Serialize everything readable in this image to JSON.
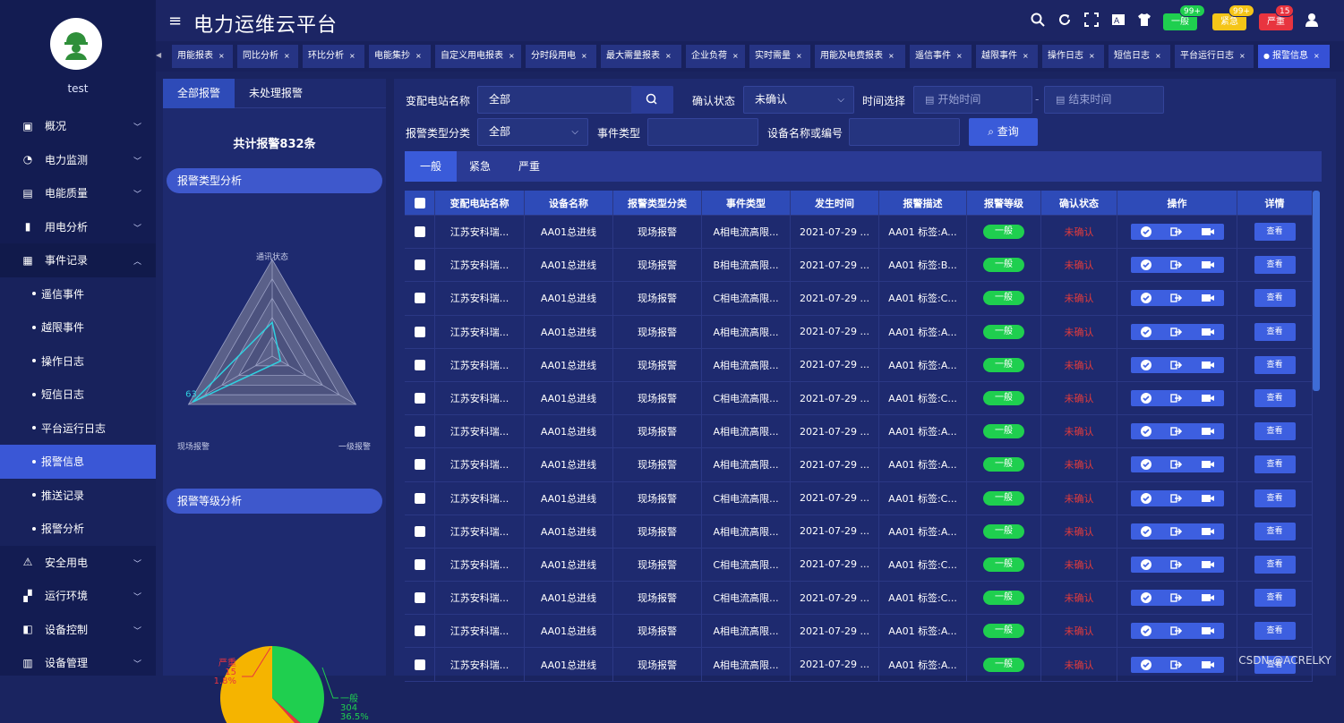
{
  "sidebar": {
    "username": "test",
    "menu": [
      {
        "label": "概况",
        "icon": "monitor-icon",
        "type": "group",
        "expanded": false
      },
      {
        "label": "电力监测",
        "icon": "gauge-icon",
        "type": "group",
        "expanded": false
      },
      {
        "label": "电能质量",
        "icon": "quality-icon",
        "type": "group",
        "expanded": false
      },
      {
        "label": "用电分析",
        "icon": "bar-chart-icon",
        "type": "group",
        "expanded": false
      },
      {
        "label": "事件记录",
        "icon": "record-icon",
        "type": "group",
        "expanded": true
      },
      {
        "label": "遥信事件",
        "type": "sub"
      },
      {
        "label": "越限事件",
        "type": "sub"
      },
      {
        "label": "操作日志",
        "type": "sub"
      },
      {
        "label": "短信日志",
        "type": "sub"
      },
      {
        "label": "平台运行日志",
        "type": "sub"
      },
      {
        "label": "报警信息",
        "type": "sub",
        "active": true
      },
      {
        "label": "推送记录",
        "type": "sub"
      },
      {
        "label": "报警分析",
        "type": "sub"
      },
      {
        "label": "安全用电",
        "icon": "safety-icon",
        "type": "group",
        "expanded": false
      },
      {
        "label": "运行环境",
        "icon": "environment-icon",
        "type": "group",
        "expanded": false
      },
      {
        "label": "设备控制",
        "icon": "device-control-icon",
        "type": "group",
        "expanded": false
      },
      {
        "label": "设备管理",
        "icon": "device-manage-icon",
        "type": "group",
        "expanded": false
      }
    ]
  },
  "header": {
    "title": "电力运维云平台",
    "alerts": [
      {
        "label": "一般",
        "badge": "99+",
        "color": "#1fcf4f"
      },
      {
        "label": "紧急",
        "badge": "99+",
        "color": "#f5c518"
      },
      {
        "label": "严重",
        "badge": "15",
        "color": "#e8343f"
      }
    ]
  },
  "tabs": [
    "用能报表",
    "同比分析",
    "环比分析",
    "电能集抄",
    "自定义用电报表",
    "分时段用电",
    "最大需量报表",
    "企业负荷",
    "实时需量",
    "用能及电费报表",
    "遥信事件",
    "越限事件",
    "操作日志",
    "短信日志",
    "平台运行日志",
    "报警信息"
  ],
  "active_tab": "报警信息",
  "left_panel": {
    "tabs": [
      "全部报警",
      "未处理报警"
    ],
    "total": "共计报警832条",
    "type_section": "报警类型分析",
    "level_section": "报警等级分析",
    "radar": {
      "axes": [
        "通讯状态",
        "一级报警",
        "现场报警"
      ],
      "value_label": "63",
      "values": [
        0.35,
        0.1,
        0.95
      ]
    },
    "pie": {
      "slices": [
        {
          "name": "一般",
          "value": 304,
          "percent": "36.5%",
          "color": "#1fcf4f"
        },
        {
          "name": "严重",
          "value": 15,
          "percent": "1.8%",
          "color": "#e8343f"
        },
        {
          "name": "紧急",
          "value": 513,
          "percent": "61.7%",
          "color": "#f5b400"
        }
      ],
      "label_general": [
        "一般",
        "304",
        "36.5%"
      ],
      "label_severe": [
        "严重",
        "15",
        "1.8%"
      ],
      "label_urgent": "紧急"
    }
  },
  "filters": {
    "station_label": "变配电站名称",
    "station_value": "全部",
    "confirm_label": "确认状态",
    "confirm_value": "未确认",
    "time_label": "时间选择",
    "start_placeholder": "开始时间",
    "end_placeholder": "结束时间",
    "alarm_type_label": "报警类型分类",
    "alarm_type_value": "全部",
    "event_type_label": "事件类型",
    "device_label": "设备名称或编号",
    "query_label": "查询",
    "dash": "-"
  },
  "table_tabs": [
    "一般",
    "紧急",
    "严重"
  ],
  "table": {
    "columns": [
      "变配电站名称",
      "设备名称",
      "报警类型分类",
      "事件类型",
      "发生时间",
      "报警描述",
      "报警等级",
      "确认状态",
      "操作",
      "详情"
    ],
    "rows": [
      [
        "江苏安科瑞...",
        "AA01总进线",
        "现场报警",
        "A相电流高限...",
        "2021-07-29 ...",
        "AA01 标签:A...",
        "一般",
        "未确认",
        "",
        "查看"
      ],
      [
        "江苏安科瑞...",
        "AA01总进线",
        "现场报警",
        "B相电流高限...",
        "2021-07-29 ...",
        "AA01 标签:B...",
        "一般",
        "未确认",
        "",
        "查看"
      ],
      [
        "江苏安科瑞...",
        "AA01总进线",
        "现场报警",
        "C相电流高限...",
        "2021-07-29 ...",
        "AA01 标签:C...",
        "一般",
        "未确认",
        "",
        "查看"
      ],
      [
        "江苏安科瑞...",
        "AA01总进线",
        "现场报警",
        "A相电流高限...",
        "2021-07-29 ...",
        "AA01 标签:A...",
        "一般",
        "未确认",
        "",
        "查看"
      ],
      [
        "江苏安科瑞...",
        "AA01总进线",
        "现场报警",
        "A相电流高限...",
        "2021-07-29 ...",
        "AA01 标签:A...",
        "一般",
        "未确认",
        "",
        "查看"
      ],
      [
        "江苏安科瑞...",
        "AA01总进线",
        "现场报警",
        "C相电流高限...",
        "2021-07-29 ...",
        "AA01 标签:C...",
        "一般",
        "未确认",
        "",
        "查看"
      ],
      [
        "江苏安科瑞...",
        "AA01总进线",
        "现场报警",
        "A相电流高限...",
        "2021-07-29 ...",
        "AA01 标签:A...",
        "一般",
        "未确认",
        "",
        "查看"
      ],
      [
        "江苏安科瑞...",
        "AA01总进线",
        "现场报警",
        "A相电流高限...",
        "2021-07-29 ...",
        "AA01 标签:A...",
        "一般",
        "未确认",
        "",
        "查看"
      ],
      [
        "江苏安科瑞...",
        "AA01总进线",
        "现场报警",
        "C相电流高限...",
        "2021-07-29 ...",
        "AA01 标签:C...",
        "一般",
        "未确认",
        "",
        "查看"
      ],
      [
        "江苏安科瑞...",
        "AA01总进线",
        "现场报警",
        "A相电流高限...",
        "2021-07-29 ...",
        "AA01 标签:A...",
        "一般",
        "未确认",
        "",
        "查看"
      ],
      [
        "江苏安科瑞...",
        "AA01总进线",
        "现场报警",
        "C相电流高限...",
        "2021-07-29 ...",
        "AA01 标签:C...",
        "一般",
        "未确认",
        "",
        "查看"
      ],
      [
        "江苏安科瑞...",
        "AA01总进线",
        "现场报警",
        "C相电流高限...",
        "2021-07-29 ...",
        "AA01 标签:C...",
        "一般",
        "未确认",
        "",
        "查看"
      ],
      [
        "江苏安科瑞...",
        "AA01总进线",
        "现场报警",
        "A相电流高限...",
        "2021-07-29 ...",
        "AA01 标签:A...",
        "一般",
        "未确认",
        "",
        "查看"
      ],
      [
        "江苏安科瑞...",
        "AA01总进线",
        "现场报警",
        "A相电流高限...",
        "2021-07-29 ...",
        "AA01 标签:A...",
        "一般",
        "未确认",
        "",
        "查看"
      ]
    ]
  },
  "watermark": "CSDN @ACRELKY"
}
